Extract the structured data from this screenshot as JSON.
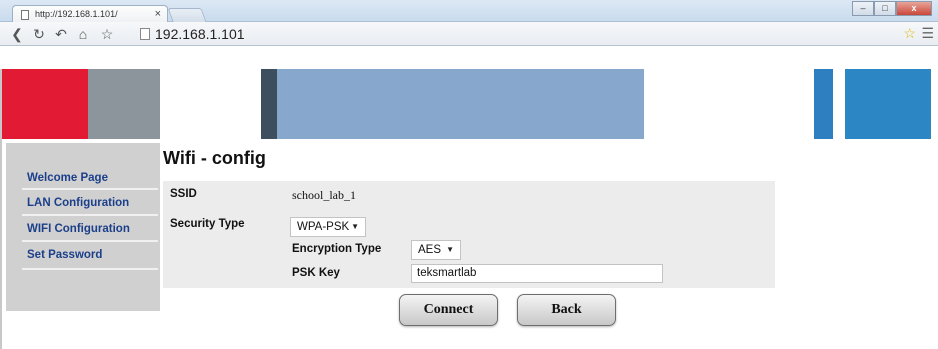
{
  "browser": {
    "tab_title": "http://192.168.1.101/",
    "tab_close": "×",
    "address": "192.168.1.101",
    "window_buttons": {
      "minimize": "–",
      "maximize": "□",
      "close": "x"
    },
    "icons": [
      "back-icon",
      "reload-icon",
      "forward-icon",
      "home-icon",
      "star-icon",
      "menu-icon"
    ]
  },
  "banner": {
    "colors": [
      "#e21a33",
      "#8c949c",
      "#3d4f5f",
      "#87a7cc",
      "#2d7fc0",
      "#2d86c4"
    ]
  },
  "sidebar": {
    "items": [
      {
        "label": "Welcome Page"
      },
      {
        "label": "LAN Configuration"
      },
      {
        "label": "WIFI Configuration"
      },
      {
        "label": "Set Password"
      }
    ]
  },
  "main": {
    "title": "Wifi - config",
    "ssid_label": "SSID",
    "ssid_value": "school_lab_1",
    "security_label": "Security Type",
    "security_value": "WPA-PSK",
    "encryption_label": "Encryption Type",
    "encryption_value": "AES",
    "psk_label": "PSK Key",
    "psk_value": "teksmartlab"
  },
  "buttons": {
    "connect": "Connect",
    "back": "Back"
  }
}
